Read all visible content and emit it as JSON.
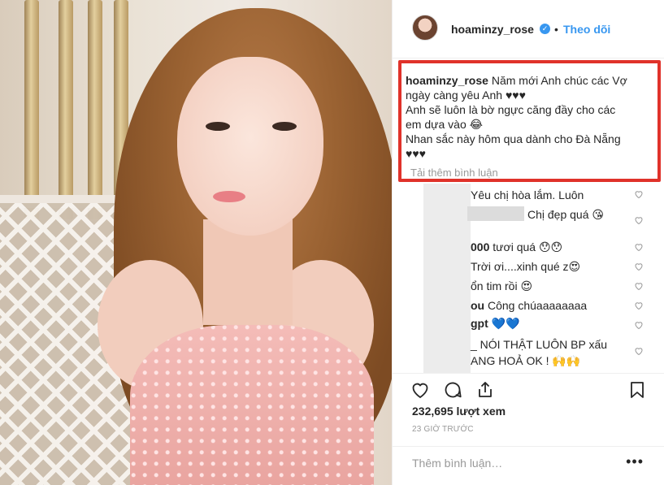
{
  "post": {
    "username": "hoaminzy_rose",
    "verified_mark": "✓",
    "separator": "•",
    "follow_label": "Theo dõi"
  },
  "caption": {
    "author": "hoaminzy_rose",
    "lines": [
      "Năm mới Anh chúc các Vợ",
      "ngày càng yêu Anh ♥♥♥",
      "Anh sẽ luôn là bờ ngực căng đầy cho các",
      "em dựa vào 😂",
      "Nhan sắc này hôm qua dành cho Đà Nẵng",
      "♥♥♥"
    ],
    "load_more": "Tải thêm bình luận"
  },
  "comments": [
    {
      "author": "",
      "text": "Yêu chị hòa lắm. Luôn"
    },
    {
      "author": "",
      "text": "Chị đẹp quá 😘"
    },
    {
      "author": "000",
      "text": " tươi quá 😯😯"
    },
    {
      "author": "",
      "text": "Trời ơi....xinh qué z😍"
    },
    {
      "author": "",
      "text": "ổn tim rồi 😍"
    },
    {
      "author": "ou",
      "text": " Công chúaaaaaaaa"
    },
    {
      "author": "gpt",
      "text": " 💙💙"
    },
    {
      "author": "",
      "text": "_ NÓI THẬT LUÔN BP xấu"
    },
    {
      "author": "",
      "text": "ANG HOẢ OK ! 🙌🙌"
    }
  ],
  "stats": {
    "views": "232,695 lượt xem",
    "time": "23 GIỜ TRƯỚC"
  },
  "add_comment": {
    "placeholder": "Thêm bình luận…",
    "more": "•••"
  },
  "icons": {
    "like": "heart-icon",
    "comment": "comment-icon",
    "share": "share-icon",
    "save": "bookmark-icon"
  },
  "colors": {
    "accent": "#3897f0",
    "highlight_border": "#e0322a",
    "muted": "#999999"
  }
}
